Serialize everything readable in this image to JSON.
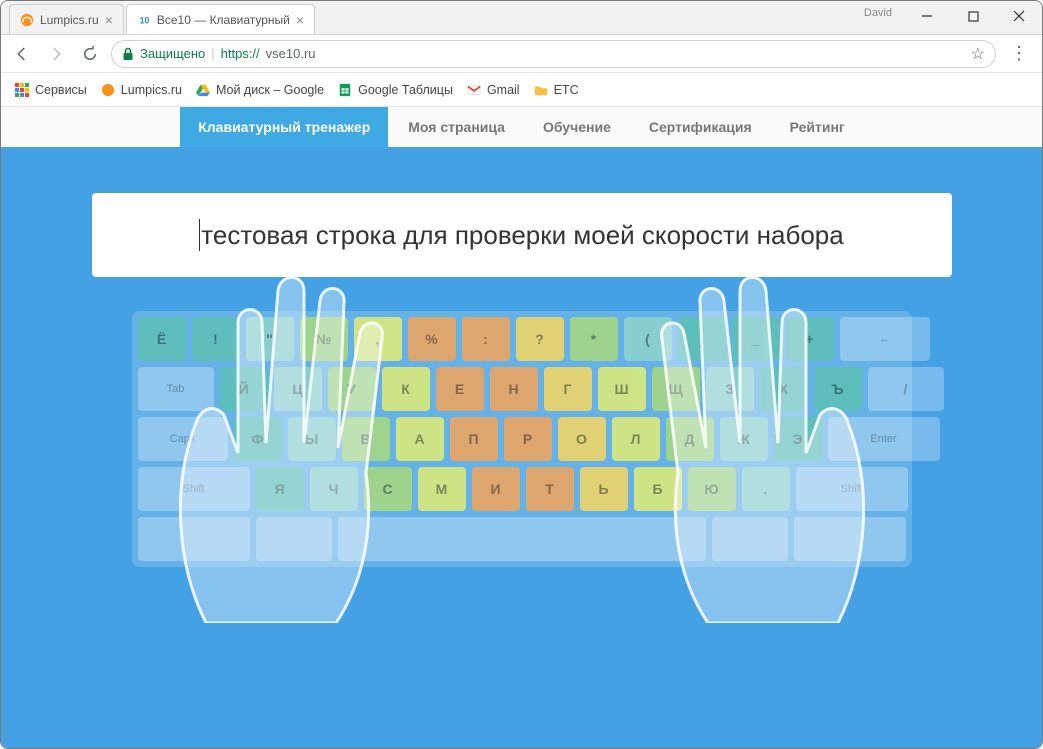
{
  "window": {
    "user": "David"
  },
  "tabs": [
    {
      "title": "Lumpics.ru"
    },
    {
      "title": "Все10 — Клавиатурный"
    }
  ],
  "address": {
    "secure_label": "Защищено",
    "protocol": "https://",
    "host": "vse10.ru"
  },
  "bookmarks": {
    "apps": "Сервисы",
    "items": [
      "Lumpics.ru",
      "Мой диск – Google",
      "Google Таблицы",
      "Gmail",
      "ETC"
    ]
  },
  "site_nav": [
    "Клавиатурный тренажер",
    "Моя страница",
    "Обучение",
    "Сертификация",
    "Рейтинг"
  ],
  "typebox_text": "тестовая строка для проверки моей скорости набора",
  "keyboard": {
    "row1": [
      {
        "l": "Ё",
        "c": "c-teal"
      },
      {
        "l": "!",
        "c": "c-teal"
      },
      {
        "l": "\"",
        "c": "c-teal-l"
      },
      {
        "l": "№",
        "c": "c-green"
      },
      {
        "l": ",",
        "c": "c-lime"
      },
      {
        "l": "%",
        "c": "c-orange"
      },
      {
        "l": ":",
        "c": "c-orange"
      },
      {
        "l": "?",
        "c": "c-yellow"
      },
      {
        "l": "*",
        "c": "c-green"
      },
      {
        "l": "(",
        "c": "c-teal-l"
      },
      {
        "l": ")",
        "c": "c-teal"
      },
      {
        "l": "_",
        "c": "c-teal"
      },
      {
        "l": "+",
        "c": "c-teal"
      },
      {
        "l": "←",
        "c": "c-blank",
        "w": "wide15",
        "sl": true
      }
    ],
    "row2_lead": {
      "l": "Tab",
      "c": "c-blank",
      "w": "wide1",
      "sl": true
    },
    "row2": [
      {
        "l": "Й",
        "c": "c-teal"
      },
      {
        "l": "Ц",
        "c": "c-teal-l"
      },
      {
        "l": "У",
        "c": "c-green"
      },
      {
        "l": "К",
        "c": "c-lime"
      },
      {
        "l": "Е",
        "c": "c-orange"
      },
      {
        "l": "Н",
        "c": "c-orange"
      },
      {
        "l": "Г",
        "c": "c-yellow"
      },
      {
        "l": "Ш",
        "c": "c-lime"
      },
      {
        "l": "Щ",
        "c": "c-green"
      },
      {
        "l": "З",
        "c": "c-teal-l"
      },
      {
        "l": "Х",
        "c": "c-teal"
      },
      {
        "l": "Ъ",
        "c": "c-teal"
      },
      {
        "l": "/",
        "c": "c-blank",
        "w": "wide1"
      }
    ],
    "row3_lead": {
      "l": "Caps",
      "c": "c-blank",
      "w": "wide15",
      "sl": true
    },
    "row3": [
      {
        "l": "Ф",
        "c": "c-teal"
      },
      {
        "l": "Ы",
        "c": "c-teal-l"
      },
      {
        "l": "В",
        "c": "c-green"
      },
      {
        "l": "А",
        "c": "c-lime"
      },
      {
        "l": "П",
        "c": "c-orange"
      },
      {
        "l": "Р",
        "c": "c-orange"
      },
      {
        "l": "О",
        "c": "c-yellow"
      },
      {
        "l": "Л",
        "c": "c-lime"
      },
      {
        "l": "Д",
        "c": "c-green"
      },
      {
        "l": "Ж",
        "c": "c-teal-l"
      },
      {
        "l": "Э",
        "c": "c-teal"
      }
    ],
    "row3_tail": {
      "l": "Enter",
      "c": "c-blank",
      "w": "wide2",
      "sl": true
    },
    "row4_lead": {
      "l": "Shift",
      "c": "c-blank",
      "w": "wide2",
      "sl": true
    },
    "row4": [
      {
        "l": "Я",
        "c": "c-teal"
      },
      {
        "l": "Ч",
        "c": "c-teal-l"
      },
      {
        "l": "С",
        "c": "c-green"
      },
      {
        "l": "М",
        "c": "c-lime"
      },
      {
        "l": "И",
        "c": "c-orange"
      },
      {
        "l": "Т",
        "c": "c-orange"
      },
      {
        "l": "Ь",
        "c": "c-yellow"
      },
      {
        "l": "Б",
        "c": "c-lime"
      },
      {
        "l": "Ю",
        "c": "c-green"
      },
      {
        "l": ".",
        "c": "c-teal-l"
      }
    ],
    "row4_tail": {
      "l": "Shift",
      "c": "c-blank",
      "w": "wide2",
      "sl": true
    }
  }
}
